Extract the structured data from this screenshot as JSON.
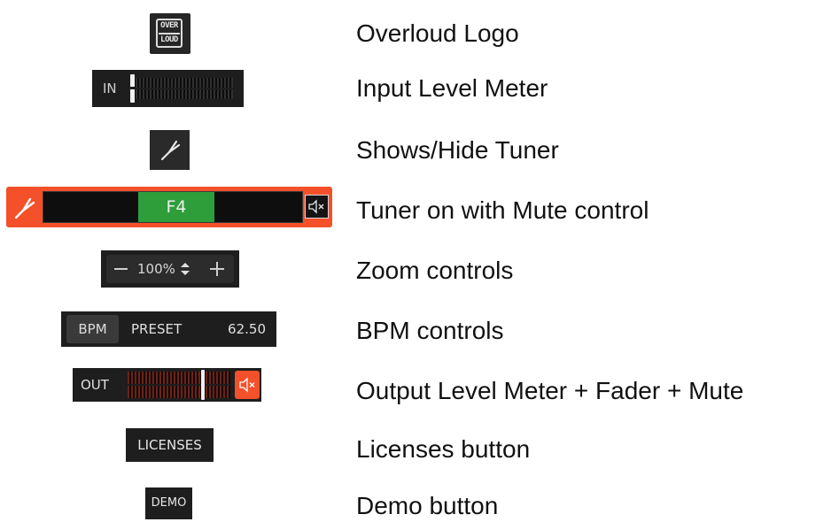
{
  "logo": {
    "line1": "OVER",
    "line2": "LOUD",
    "icon": "overloud-logo"
  },
  "input_meter": {
    "label": "IN",
    "icon": "input-level-meter"
  },
  "tuner_button": {
    "icon": "tuning-fork-icon"
  },
  "tuner": {
    "note": "F4",
    "icons": [
      "tuning-fork-icon",
      "speaker-mute-icon"
    ],
    "accent": "#f4502a",
    "note_color": "#2e9e3a"
  },
  "zoom": {
    "value": "100%",
    "icons": [
      "minus-icon",
      "up-down-arrows-icon",
      "plus-icon"
    ]
  },
  "bpm": {
    "bpm_label": "BPM",
    "preset_label": "PRESET",
    "value": "62.50"
  },
  "output_meter": {
    "label": "OUT",
    "icon": "speaker-mute-icon",
    "accent": "#f4502a"
  },
  "buttons": {
    "licenses": "LICENSES",
    "demo": "DEMO"
  },
  "descriptions": [
    "Overloud Logo",
    "Input Level Meter",
    "Shows/Hide Tuner",
    "Tuner on with Mute control",
    "Zoom controls",
    "BPM controls",
    "Output Level Meter + Fader + Mute",
    "Licenses button",
    "Demo button"
  ]
}
